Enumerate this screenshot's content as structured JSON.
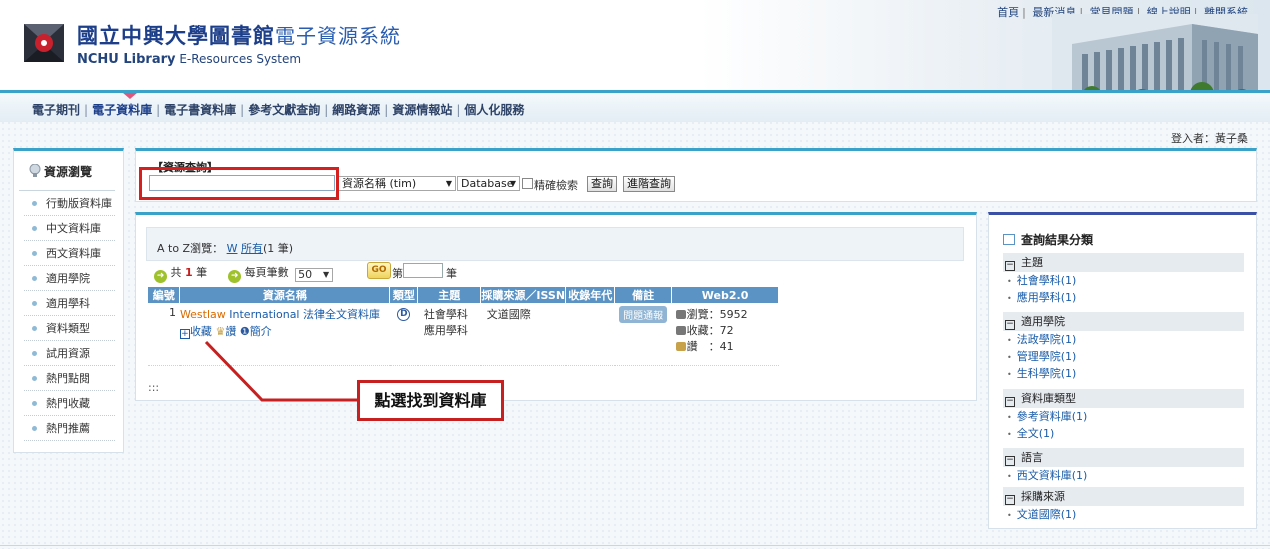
{
  "header": {
    "title_main": "國立中興大學圖書館",
    "title_sub": "電子資源系統",
    "title_en_bold": "NCHU Library",
    "title_en_rest": "E-Resources System",
    "top_links": [
      "首頁",
      "最新消息",
      "常見問題",
      "線上說明",
      "離開系統"
    ]
  },
  "nav": {
    "items": [
      "電子期刊",
      "電子資料庫",
      "電子書資料庫",
      "參考文獻查詢",
      "網路資源",
      "資源情報站",
      "個人化服務"
    ],
    "active_index": 1
  },
  "login": "登入者：黃子桑",
  "sidebar": {
    "title": "資源瀏覽",
    "items": [
      "行動版資料庫",
      "中文資料庫",
      "西文資料庫",
      "適用學院",
      "適用學科",
      "資料類型",
      "試用資源",
      "熱門點閱",
      "熱門收藏",
      "熱門推薦"
    ]
  },
  "search": {
    "label": "【資源查詢】",
    "input_value": "",
    "field_select": "資源名稱 (tim)",
    "type_select": "Database",
    "exact_label": "精確檢索",
    "search_btn": "查詢",
    "advanced_btn": "進階查詢"
  },
  "results": {
    "az_prefix": "A to Z瀏覽：",
    "az_letter": "W",
    "az_all": "所有",
    "az_count": "(1 筆)",
    "total_prefix": "共",
    "total_count": "1",
    "total_suffix": "筆",
    "per_page_label": "每頁筆數",
    "per_page_value": "50",
    "go_label": "GO",
    "page_prefix": "第",
    "page_suffix": "筆",
    "columns": [
      "編號",
      "資源名稱",
      "類型",
      "主題",
      "採購來源／ISSN",
      "收錄年代",
      "備註",
      "Web2.0"
    ],
    "rows": [
      {
        "no": "1",
        "name_part1": "Westlaw",
        "name_part2": "International 法律全文資料庫",
        "actions": [
          "收藏",
          "讚",
          "簡介"
        ],
        "type": "D",
        "subject1": "社會學科",
        "subject2": "應用學科",
        "source": "文道國際",
        "years": "",
        "note": "問題通報",
        "views_label": "瀏覽：5952",
        "saves_label": "收藏：72",
        "likes_label": "讚　：41"
      }
    ],
    "more": ":::"
  },
  "annotation": "點選找到資料庫",
  "facets": {
    "title": "查詢結果分類",
    "groups": [
      {
        "title": "主題",
        "items": [
          "社會學科(1)",
          "應用學科(1)"
        ]
      },
      {
        "title": "適用學院",
        "items": [
          "法政學院(1)",
          "管理學院(1)",
          "生科學院(1)"
        ]
      },
      {
        "title": "資料庫類型",
        "items": [
          "參考資料庫(1)",
          "全文(1)"
        ]
      },
      {
        "title": "語言",
        "items": [
          "西文資料庫(1)"
        ]
      },
      {
        "title": "採購來源",
        "items": [
          "文道國際(1)"
        ]
      }
    ]
  },
  "colors": {
    "accent": "#3aa1c9",
    "table_header": "#5b93c4",
    "highlight_red": "#d62020",
    "brand_blue": "#1d3f8a"
  }
}
